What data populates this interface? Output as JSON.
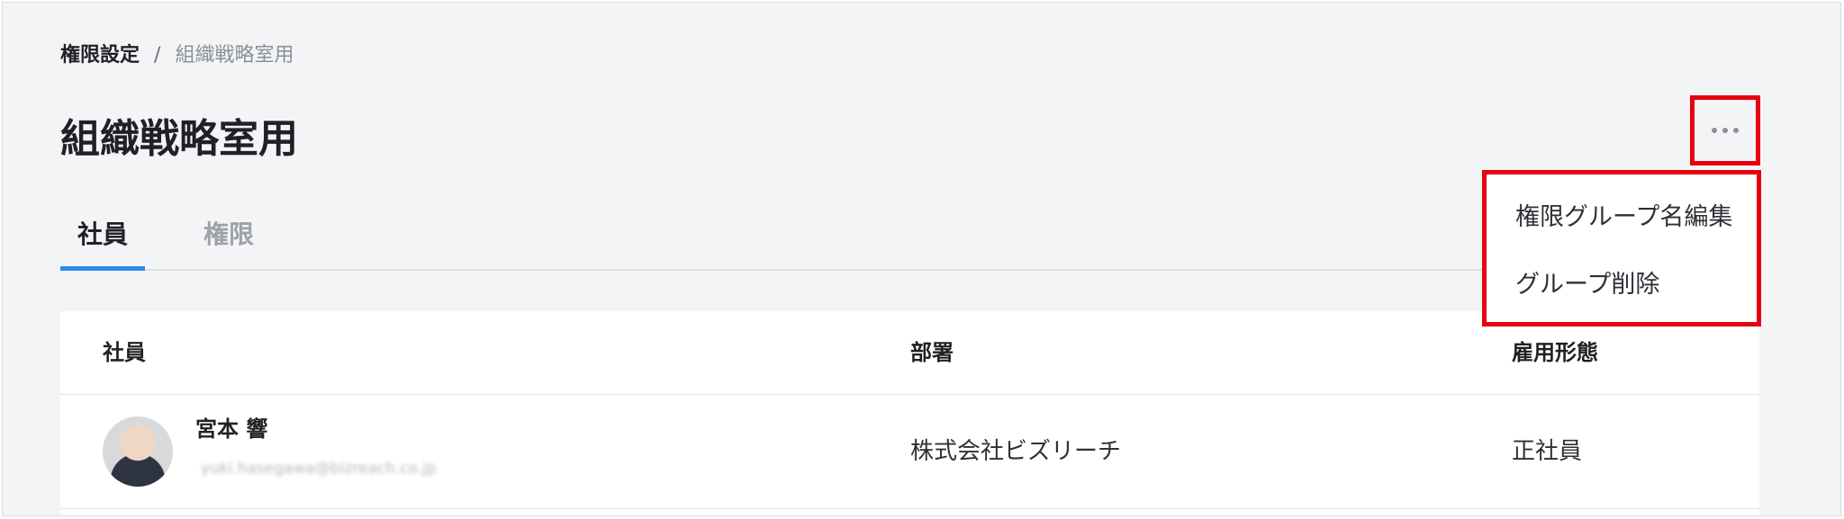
{
  "breadcrumb": {
    "current": "権限設定",
    "separator": "/",
    "item": "組織戦略室用"
  },
  "page": {
    "title": "組織戦略室用"
  },
  "tabs": [
    {
      "label": "社員",
      "active": true
    },
    {
      "label": "権限",
      "active": false
    }
  ],
  "actions": {
    "more_icon": "more-horizontal-icon"
  },
  "menu": {
    "items": [
      {
        "label": "権限グループ名編集"
      },
      {
        "label": "グループ削除"
      }
    ]
  },
  "table": {
    "columns": [
      "社員",
      "部署",
      "雇用形態"
    ],
    "rows": [
      {
        "name": "宮本 響",
        "email": "yuki.hasegawa@bizreach.co.jp",
        "department": "株式会社ビズリーチ",
        "employment_type": "正社員"
      }
    ]
  },
  "colors": {
    "accent_tab": "#2b8be6",
    "highlight_box": "#e60012",
    "background": "#f3f4f6"
  }
}
